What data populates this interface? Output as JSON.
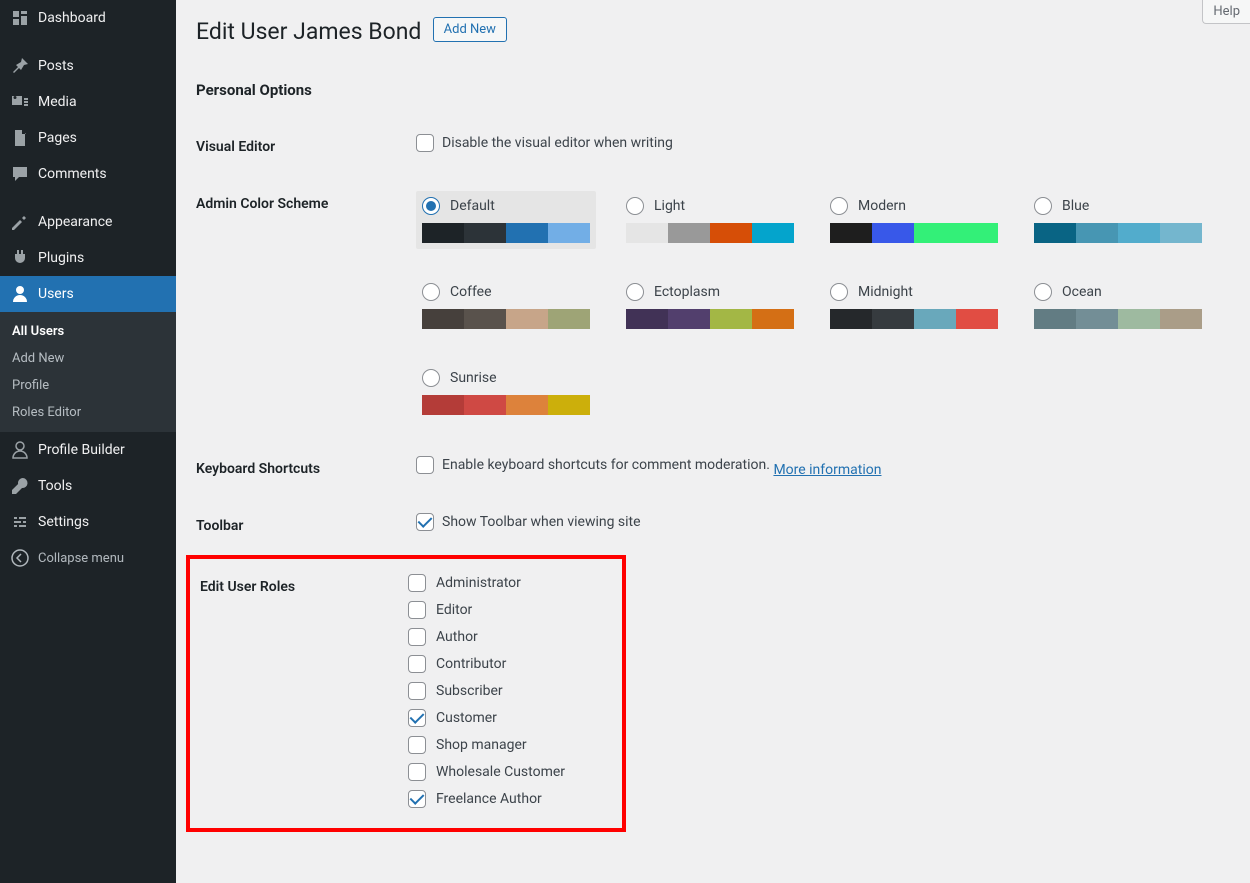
{
  "sidebar": {
    "items": [
      {
        "label": "Dashboard"
      },
      {
        "label": "Posts"
      },
      {
        "label": "Media"
      },
      {
        "label": "Pages"
      },
      {
        "label": "Comments"
      },
      {
        "label": "Appearance"
      },
      {
        "label": "Plugins"
      },
      {
        "label": "Users"
      },
      {
        "label": "Profile Builder"
      },
      {
        "label": "Tools"
      },
      {
        "label": "Settings"
      }
    ],
    "submenu": [
      {
        "label": "All Users"
      },
      {
        "label": "Add New"
      },
      {
        "label": "Profile"
      },
      {
        "label": "Roles Editor"
      }
    ],
    "collapse_label": "Collapse menu"
  },
  "help_label": "Help",
  "header": {
    "title": "Edit User James Bond",
    "add_new_label": "Add New"
  },
  "section_personal_options": "Personal Options",
  "row_visual_editor": {
    "label": "Visual Editor",
    "option": "Disable the visual editor when writing",
    "checked": false
  },
  "row_color_scheme": {
    "label": "Admin Color Scheme",
    "schemes": [
      {
        "name": "Default",
        "selected": true,
        "colors": [
          "#1d2327",
          "#2c3338",
          "#2271b1",
          "#72aee6"
        ]
      },
      {
        "name": "Light",
        "selected": false,
        "colors": [
          "#e5e5e5",
          "#999999",
          "#d64e07",
          "#04a4cc"
        ]
      },
      {
        "name": "Modern",
        "selected": false,
        "colors": [
          "#1e1e1e",
          "#3858e9",
          "#33f078",
          "#33f078"
        ]
      },
      {
        "name": "Blue",
        "selected": false,
        "colors": [
          "#096484",
          "#4796b3",
          "#52accc",
          "#74b6ce"
        ]
      },
      {
        "name": "Coffee",
        "selected": false,
        "colors": [
          "#46403c",
          "#59524c",
          "#c7a589",
          "#9ea476"
        ]
      },
      {
        "name": "Ectoplasm",
        "selected": false,
        "colors": [
          "#413256",
          "#523f6d",
          "#a3b745",
          "#d46f15"
        ]
      },
      {
        "name": "Midnight",
        "selected": false,
        "colors": [
          "#25282b",
          "#363b3f",
          "#69a8bb",
          "#e14d43"
        ]
      },
      {
        "name": "Ocean",
        "selected": false,
        "colors": [
          "#627c83",
          "#738e96",
          "#9ebaa0",
          "#aa9d88"
        ]
      },
      {
        "name": "Sunrise",
        "selected": false,
        "colors": [
          "#b43c38",
          "#cf4944",
          "#dd823b",
          "#ccaf0b"
        ]
      }
    ]
  },
  "row_shortcuts": {
    "label": "Keyboard Shortcuts",
    "option": "Enable keyboard shortcuts for comment moderation.",
    "more_info": "More information",
    "checked": false
  },
  "row_toolbar": {
    "label": "Toolbar",
    "option": "Show Toolbar when viewing site",
    "checked": true
  },
  "row_roles": {
    "label": "Edit User Roles",
    "roles": [
      {
        "name": "Administrator",
        "checked": false
      },
      {
        "name": "Editor",
        "checked": false
      },
      {
        "name": "Author",
        "checked": false
      },
      {
        "name": "Contributor",
        "checked": false
      },
      {
        "name": "Subscriber",
        "checked": false
      },
      {
        "name": "Customer",
        "checked": true
      },
      {
        "name": "Shop manager",
        "checked": false
      },
      {
        "name": "Wholesale Customer",
        "checked": false
      },
      {
        "name": "Freelance Author",
        "checked": true
      }
    ]
  }
}
